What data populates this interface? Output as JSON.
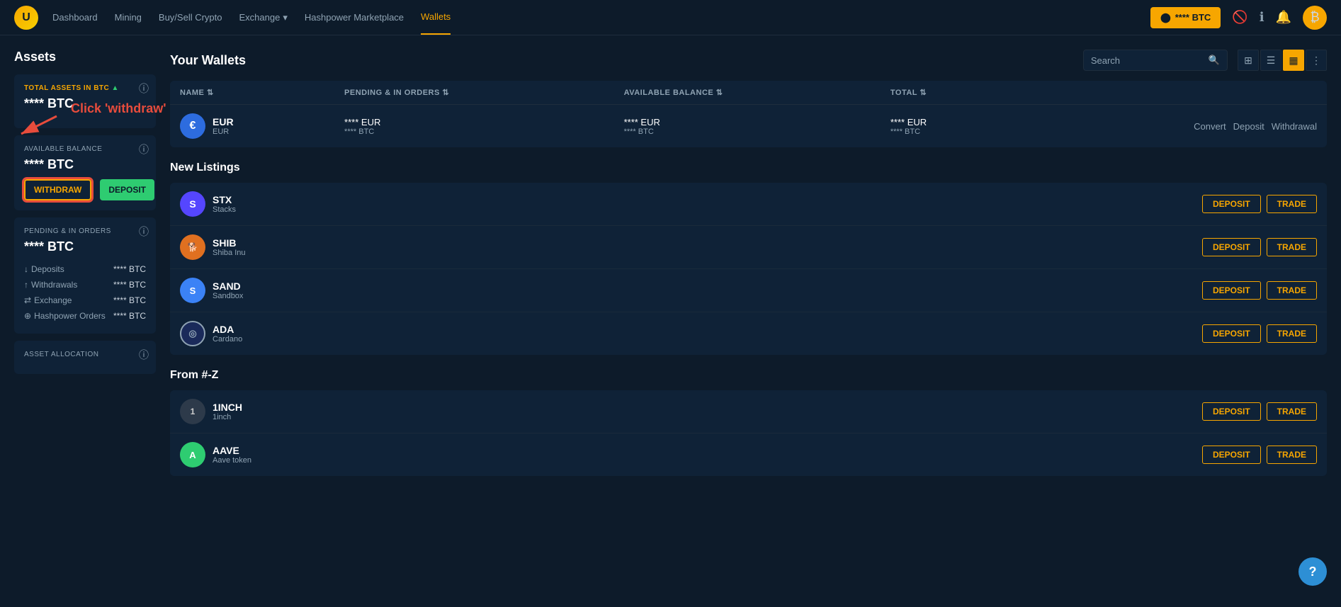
{
  "app": {
    "logo": "U",
    "nav": {
      "links": [
        {
          "label": "Dashboard",
          "active": false
        },
        {
          "label": "Mining",
          "active": false
        },
        {
          "label": "Buy/Sell Crypto",
          "active": false
        },
        {
          "label": "Exchange",
          "active": false,
          "has_dropdown": true
        },
        {
          "label": "Hashpower Marketplace",
          "active": false
        },
        {
          "label": "Wallets",
          "active": true
        }
      ],
      "btc_button": "**** BTC",
      "icons": [
        "no-eye",
        "info",
        "bell",
        "bitcoin"
      ]
    }
  },
  "sidebar": {
    "title": "Assets",
    "total_assets": {
      "label": "TOTAL ASSETS IN",
      "currency": "BTC",
      "value": "**** BTC"
    },
    "available_balance": {
      "label": "AVAILABLE BALANCE",
      "value": "**** BTC",
      "withdraw_label": "WITHDRAW",
      "deposit_label": "DEPOSIT"
    },
    "pending_orders": {
      "label": "PENDING & IN ORDERS",
      "value": "**** BTC",
      "rows": [
        {
          "icon": "↓",
          "label": "Deposits",
          "value": "**** BTC"
        },
        {
          "icon": "↑",
          "label": "Withdrawals",
          "value": "**** BTC"
        },
        {
          "icon": "⇄",
          "label": "Exchange",
          "value": "**** BTC"
        },
        {
          "icon": "⊕",
          "label": "Hashpower Orders",
          "value": "**** BTC"
        }
      ]
    },
    "asset_allocation": {
      "label": "ASSET ALLOCATION"
    }
  },
  "wallets": {
    "title": "Your Wallets",
    "search_placeholder": "Search",
    "view_modes": [
      "grid",
      "list",
      "table",
      "more"
    ],
    "table": {
      "headers": [
        "NAME",
        "PENDING & IN ORDERS",
        "AVAILABLE BALANCE",
        "TOTAL"
      ],
      "rows": [
        {
          "icon": "€",
          "icon_bg": "eur",
          "name": "EUR",
          "ticker": "EUR",
          "pending_main": "**** EUR",
          "pending_sub": "**** BTC",
          "available_main": "**** EUR",
          "available_sub": "**** BTC",
          "total_main": "**** EUR",
          "total_sub": "**** BTC",
          "actions": [
            "Convert",
            "Deposit",
            "Withdrawal"
          ]
        }
      ]
    }
  },
  "annotation": {
    "text": "Click 'withdraw'"
  },
  "new_listings": {
    "title": "New Listings",
    "items": [
      {
        "icon": "S",
        "icon_class": "ci-stx",
        "name": "STX",
        "fullname": "Stacks"
      },
      {
        "icon": "🐕",
        "icon_class": "ci-shib",
        "name": "SHIB",
        "fullname": "Shiba Inu"
      },
      {
        "icon": "S",
        "icon_class": "ci-sand",
        "name": "SAND",
        "fullname": "Sandbox"
      },
      {
        "icon": "◎",
        "icon_class": "ci-ada",
        "name": "ADA",
        "fullname": "Cardano"
      }
    ],
    "deposit_label": "DEPOSIT",
    "trade_label": "TRADE"
  },
  "from_z": {
    "title": "From #-Z",
    "items": [
      {
        "icon": "1",
        "icon_class": "ci-1inch",
        "name": "1INCH",
        "fullname": "1inch"
      },
      {
        "icon": "A",
        "icon_class": "ci-aave",
        "name": "AAVE",
        "fullname": "Aave token"
      }
    ],
    "deposit_label": "DEPOSIT",
    "trade_label": "TRADE"
  },
  "help": {
    "label": "?"
  }
}
